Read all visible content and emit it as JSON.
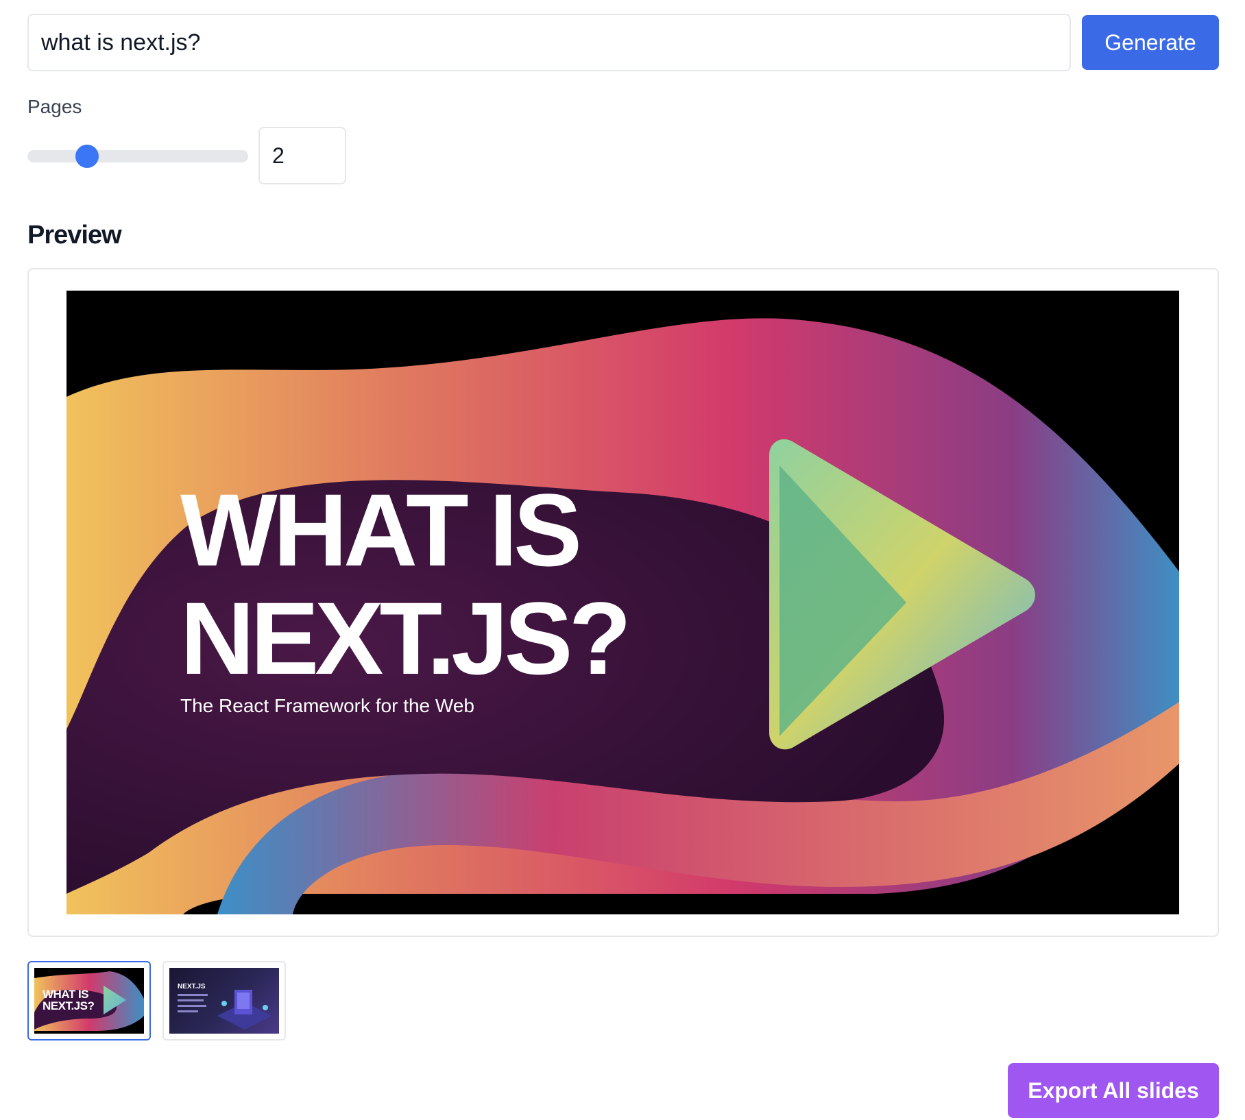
{
  "prompt": {
    "value": "what is next.js?",
    "generate_label": "Generate"
  },
  "pages": {
    "label": "Pages",
    "value": "2",
    "slider_fraction": 0.27
  },
  "preview": {
    "heading": "Preview",
    "slide": {
      "title": "WHAT IS\nNEXT.JS?",
      "subtitle": "The React Framework for the Web"
    }
  },
  "thumbnails": [
    {
      "title": "WHAT IS\nNEXT.JS?",
      "selected": true
    },
    {
      "title": "NEXT.JS",
      "selected": false
    }
  ],
  "export": {
    "label": "Export All slides"
  },
  "colors": {
    "primary": "#3a6ae6",
    "export": "#a056f0",
    "slider_thumb": "#3b76f6",
    "border": "#e5e7eb"
  }
}
